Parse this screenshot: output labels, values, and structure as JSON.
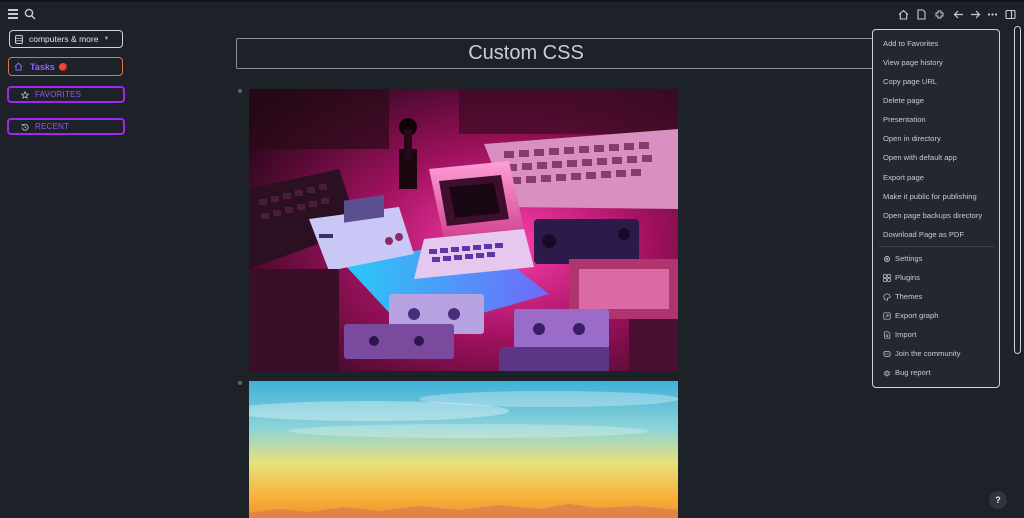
{
  "sidebar": {
    "graph_name": "computers & more",
    "tasks_label": "Tasks",
    "favorites_label": "FAVORITES",
    "recent_label": "RECENT"
  },
  "page": {
    "title": "Custom CSS"
  },
  "menu": {
    "items": [
      "Add to Favorites",
      "View page history",
      "Copy page URL",
      "Delete page",
      "Presentation",
      "Open in directory",
      "Open with default app",
      "Export page",
      "Make it public for publishing",
      "Open page backups directory",
      "Download Page as PDF"
    ],
    "app_items": [
      {
        "label": "Settings",
        "icon": "gear-icon"
      },
      {
        "label": "Plugins",
        "icon": "plugins-icon"
      },
      {
        "label": "Themes",
        "icon": "palette-icon"
      },
      {
        "label": "Export graph",
        "icon": "export-icon"
      },
      {
        "label": "Import",
        "icon": "import-icon"
      },
      {
        "label": "Join the community",
        "icon": "community-icon"
      },
      {
        "label": "Bug report",
        "icon": "bug-icon"
      }
    ]
  },
  "help": {
    "label": "?"
  },
  "colors": {
    "accent_purple": "#8b5cf6",
    "border_magenta": "#a424f0",
    "tasks_border": "#e8704a",
    "background": "#1d2128"
  }
}
